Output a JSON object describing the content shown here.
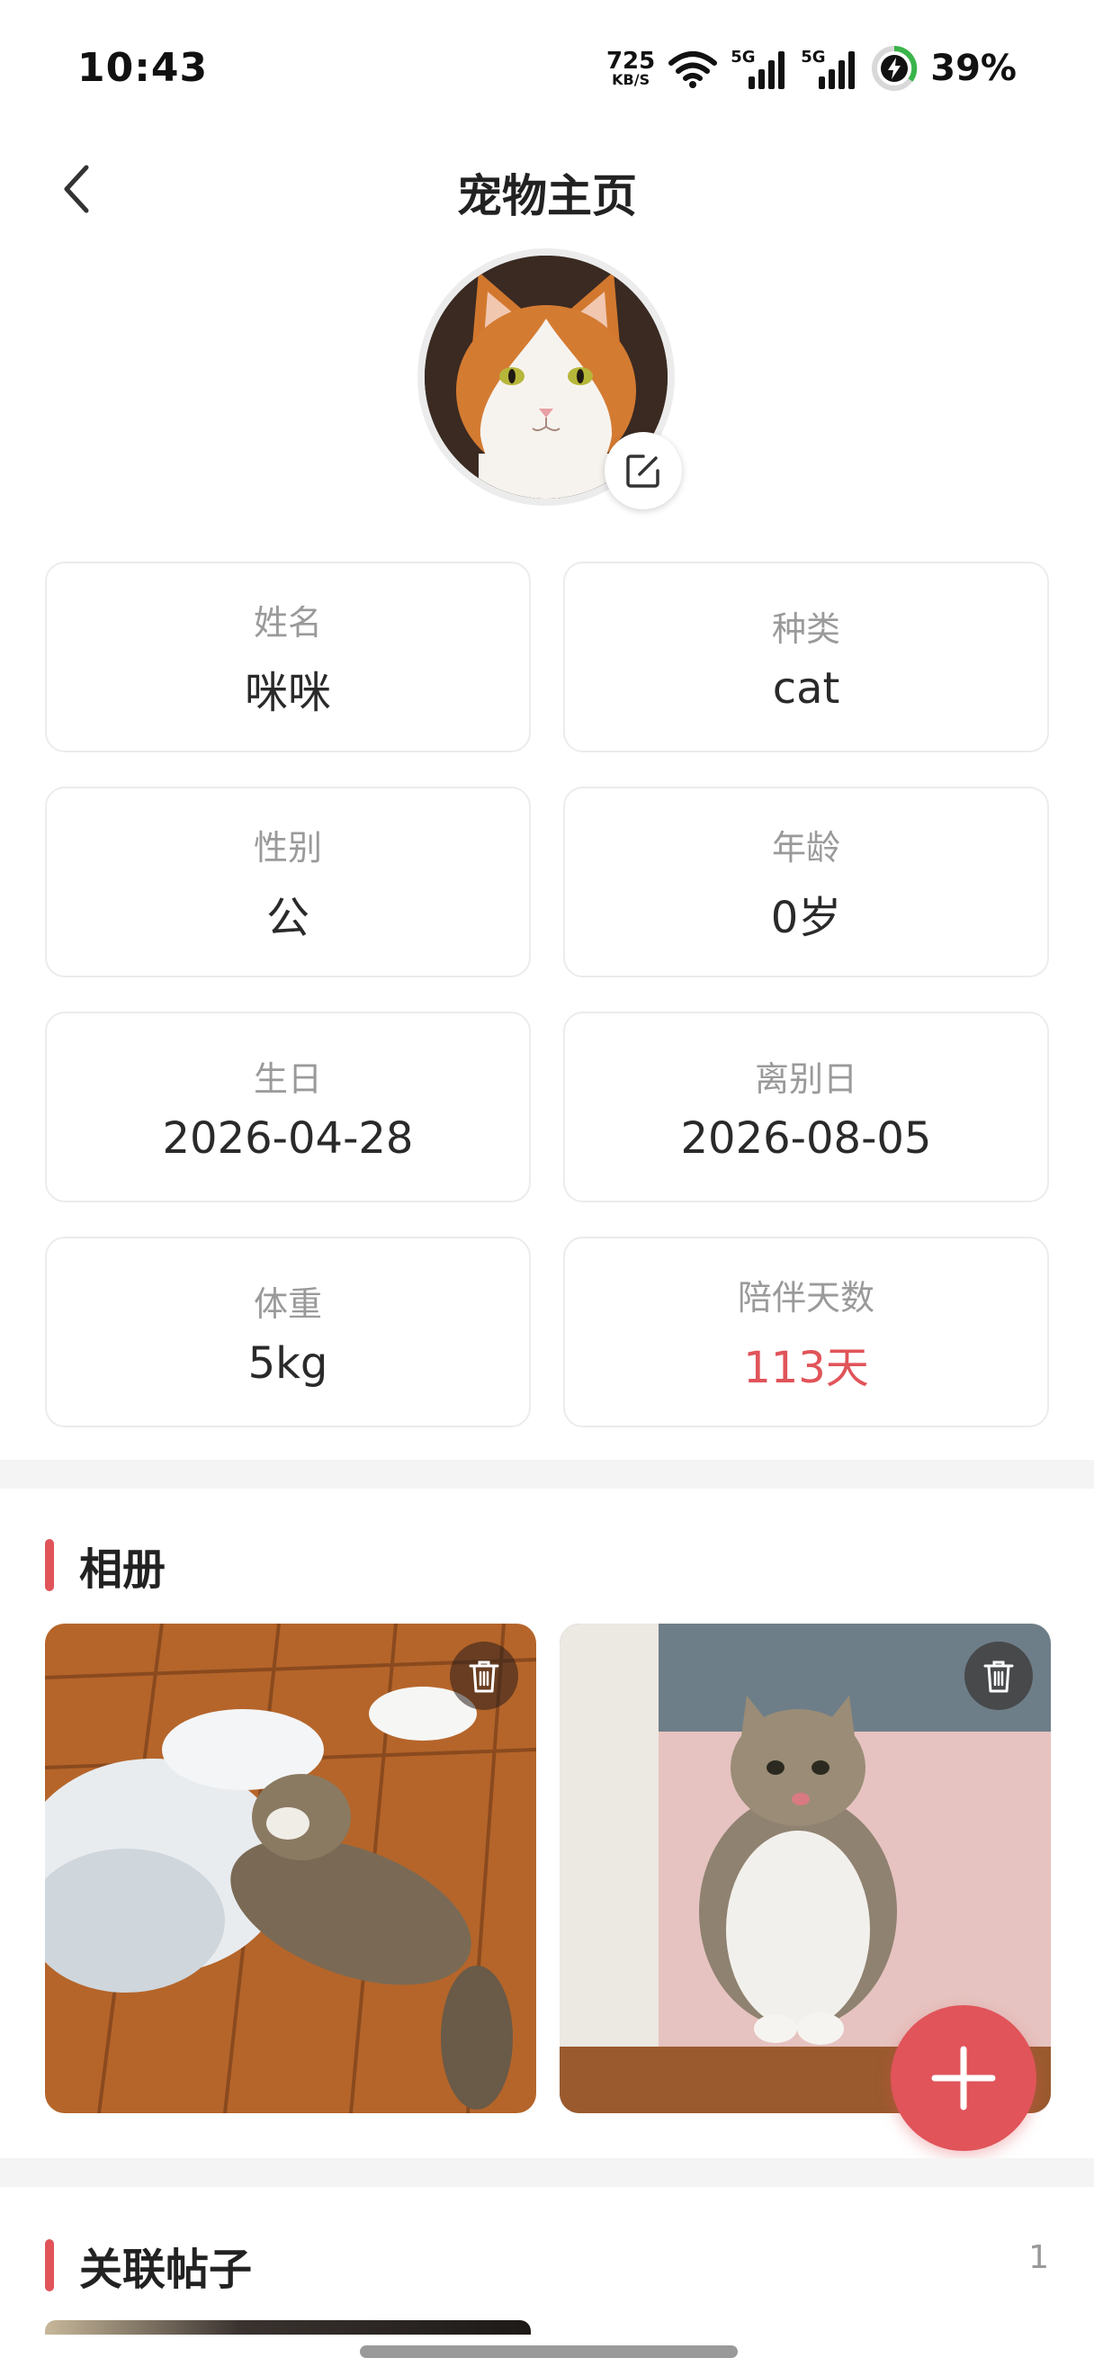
{
  "status_bar": {
    "time": "10:43",
    "net_speed_value": "725",
    "net_speed_unit": "KB/S",
    "signal1_label": "5G",
    "signal2_label": "5G",
    "battery_percent": "39%"
  },
  "header": {
    "title": "宠物主页",
    "back_icon": "chevron-left-icon"
  },
  "avatar": {
    "edit_icon": "edit-icon"
  },
  "info": {
    "name": {
      "label": "姓名",
      "value": "咪咪"
    },
    "species": {
      "label": "种类",
      "value": "cat"
    },
    "gender": {
      "label": "性别",
      "value": "公"
    },
    "age": {
      "label": "年龄",
      "value": "0岁"
    },
    "birthday": {
      "label": "生日",
      "value": "2026-04-28"
    },
    "farewell": {
      "label": "离别日",
      "value": "2026-08-05"
    },
    "weight": {
      "label": "体重",
      "value": "5kg"
    },
    "days": {
      "label": "陪伴天数",
      "value": "113天"
    }
  },
  "album": {
    "title": "相册",
    "delete_icon": "trash-icon"
  },
  "posts": {
    "title": "关联帖子",
    "count": "1"
  },
  "fab": {
    "icon": "plus-icon"
  },
  "colors": {
    "accent": "#e0545a",
    "label_gray": "#9a9a9a",
    "card_border": "#ececec",
    "band_gray": "#f4f4f4"
  }
}
